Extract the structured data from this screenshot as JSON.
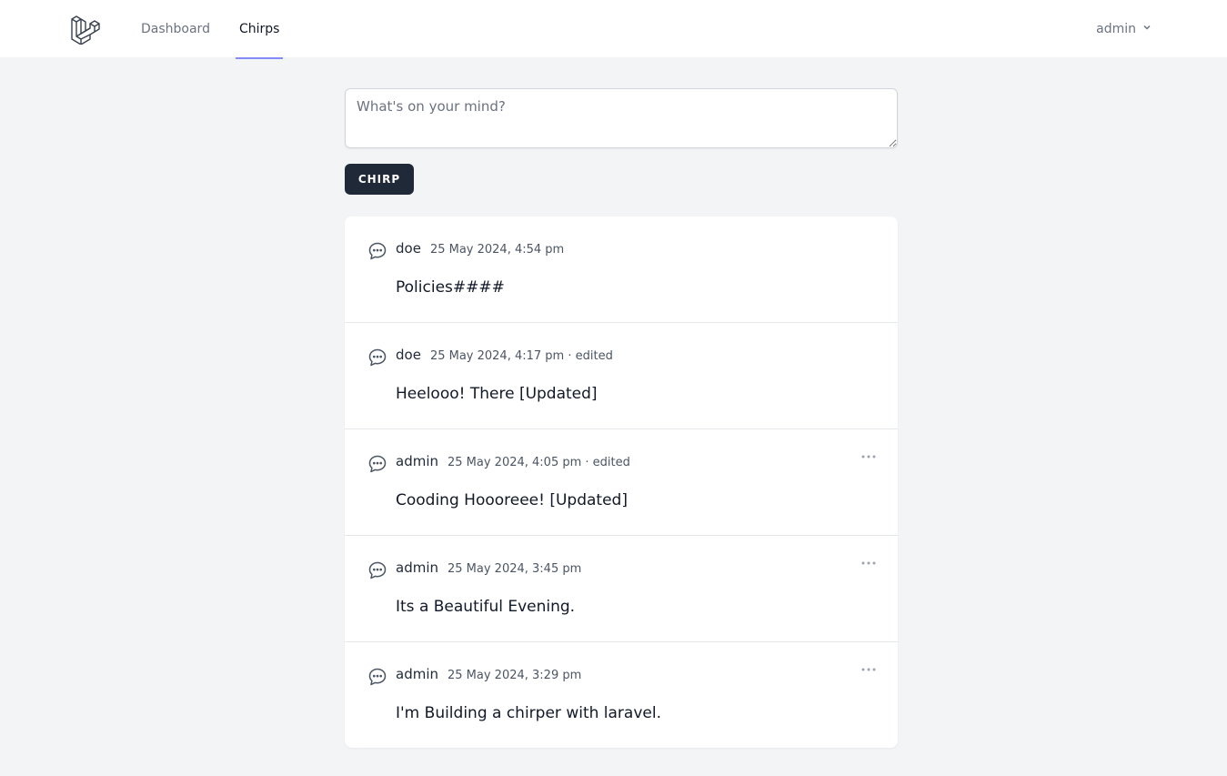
{
  "nav": {
    "links": [
      {
        "label": "Dashboard",
        "active": false
      },
      {
        "label": "Chirps",
        "active": true
      }
    ],
    "user": {
      "name": "admin"
    }
  },
  "composer": {
    "placeholder": "What's on your mind?",
    "value": "",
    "submit_label": "CHIRP"
  },
  "chirps": [
    {
      "author": "doe",
      "time": "25 May 2024, 4:54 pm",
      "edited": "",
      "message": "Policies####",
      "has_menu": false
    },
    {
      "author": "doe",
      "time": "25 May 2024, 4:17 pm",
      "edited": "· edited",
      "message": "Heelooo! There [Updated]",
      "has_menu": false
    },
    {
      "author": "admin",
      "time": "25 May 2024, 4:05 pm",
      "edited": "· edited",
      "message": "Cooding Hoooreee! [Updated]",
      "has_menu": true
    },
    {
      "author": "admin",
      "time": "25 May 2024, 3:45 pm",
      "edited": "",
      "message": "Its a Beautiful Evening.",
      "has_menu": true
    },
    {
      "author": "admin",
      "time": "25 May 2024, 3:29 pm",
      "edited": "",
      "message": "I'm Building a chirper with laravel.",
      "has_menu": true
    }
  ],
  "icons": {
    "logo": "laravel-logo-icon",
    "chirp": "chat-bubble-icon",
    "menu": "ellipsis-horizontal-icon",
    "dropdown": "chevron-down-icon"
  },
  "colors": {
    "accent": "#818cf8",
    "button_bg": "#1f2937",
    "page_bg": "#f3f4f6"
  }
}
